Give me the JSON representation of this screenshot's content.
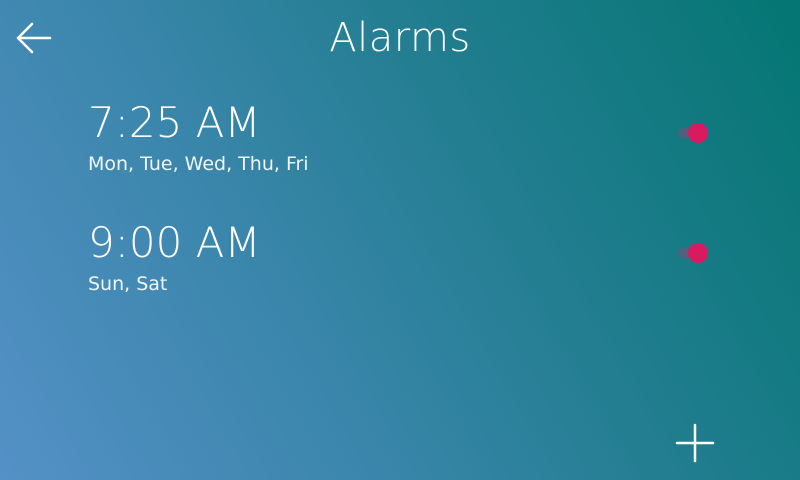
{
  "header": {
    "title": "Alarms",
    "back_icon": "arrow-left-icon"
  },
  "alarms": [
    {
      "time": "7:25 AM",
      "days": "Mon, Tue, Wed, Thu, Fri",
      "enabled": true
    },
    {
      "time": "9:00 AM",
      "days": "Sun, Sat",
      "enabled": true
    }
  ],
  "footer": {
    "add_icon": "plus-icon"
  },
  "colors": {
    "toggle_on": "#d81b60",
    "text": "#ffffff",
    "background_start": "#5491c6",
    "background_end": "#047673"
  }
}
